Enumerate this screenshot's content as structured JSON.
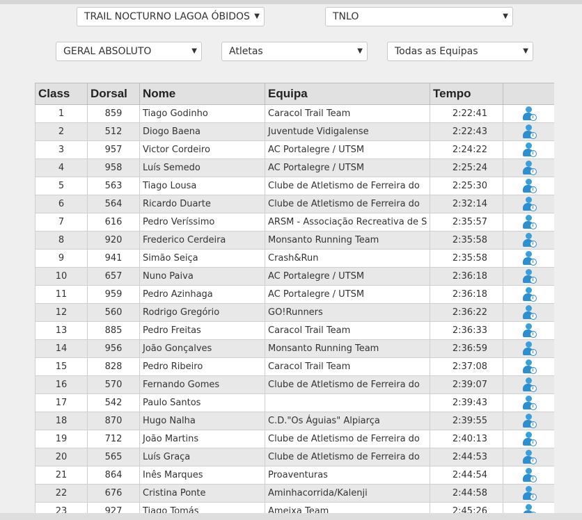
{
  "filters": {
    "event": "TRAIL NOCTURNO LAGOA ÓBIDOS",
    "race": "TNLO",
    "category": "GERAL ABSOLUTO",
    "type": "Atletas",
    "team": "Todas as Equipas"
  },
  "table": {
    "headers": [
      "Class",
      "Dorsal",
      "Nome",
      "Equipa",
      "Tempo",
      ""
    ],
    "rows": [
      [
        "1",
        "859",
        "Tiago Godinho",
        "Caracol Trail Team",
        "2:22:41"
      ],
      [
        "2",
        "512",
        "Diogo Baena",
        "Juventude Vidigalense",
        "2:22:43"
      ],
      [
        "3",
        "957",
        "Victor Cordeiro",
        "AC Portalegre / UTSM",
        "2:24:22"
      ],
      [
        "4",
        "958",
        "Luís Semedo",
        "AC Portalegre / UTSM",
        "2:25:24"
      ],
      [
        "5",
        "563",
        "Tiago Lousa",
        "Clube de Atletismo de Ferreira do",
        "2:25:30"
      ],
      [
        "6",
        "564",
        "Ricardo Duarte",
        "Clube de Atletismo de Ferreira do",
        "2:32:14"
      ],
      [
        "7",
        "616",
        "Pedro Veríssimo",
        "ARSM - Associação Recreativa de S",
        "2:35:57"
      ],
      [
        "8",
        "920",
        "Frederico Cerdeira",
        "Monsanto Running Team",
        "2:35:58"
      ],
      [
        "9",
        "941",
        "Simão Seiça",
        "Crash&Run",
        "2:35:58"
      ],
      [
        "10",
        "657",
        "Nuno Paiva",
        "AC Portalegre / UTSM",
        "2:36:18"
      ],
      [
        "11",
        "959",
        "Pedro Azinhaga",
        "AC Portalegre / UTSM",
        "2:36:18"
      ],
      [
        "12",
        "560",
        "Rodrigo Gregório",
        "GO!Runners",
        "2:36:22"
      ],
      [
        "13",
        "885",
        "Pedro Freitas",
        "Caracol Trail Team",
        "2:36:33"
      ],
      [
        "14",
        "956",
        "João Gonçalves",
        "Monsanto Running Team",
        "2:36:59"
      ],
      [
        "15",
        "828",
        "Pedro Ribeiro",
        "Caracol Trail Team",
        "2:37:08"
      ],
      [
        "16",
        "570",
        "Fernando Gomes",
        "Clube de Atletismo de Ferreira do",
        "2:39:07"
      ],
      [
        "17",
        "542",
        "Paulo Santos",
        "",
        "2:39:43"
      ],
      [
        "18",
        "870",
        "Hugo Nalha",
        "C.D.\"Os Águias\" Alpiarça",
        "2:39:55"
      ],
      [
        "19",
        "712",
        "João Martins",
        "Clube de Atletismo de Ferreira do",
        "2:40:13"
      ],
      [
        "20",
        "565",
        "Luís Graça",
        "Clube de Atletismo de Ferreira do",
        "2:44:53"
      ],
      [
        "21",
        "864",
        "Inês Marques",
        "Proaventuras",
        "2:44:54"
      ],
      [
        "22",
        "676",
        "Cristina Ponte",
        "Aminhacorrida/Kalenji",
        "2:44:58"
      ],
      [
        "23",
        "927",
        "Tiago Tomás",
        "Ameixa Team",
        "2:45:26"
      ]
    ]
  },
  "icons": {
    "row_action": "athlete-info-icon",
    "dropdown": "chevron-down-icon"
  },
  "colors": {
    "header_bg": "#e1e1e1",
    "row_alt": "#e8e8e8",
    "icon": "#2e8fd0"
  }
}
